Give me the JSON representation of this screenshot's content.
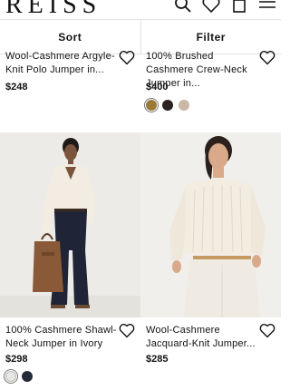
{
  "header": {
    "logo": "REISS"
  },
  "toolbar": {
    "sort_label": "Sort",
    "filter_label": "Filter"
  },
  "products_top": [
    {
      "title": "Wool-Cashmere Argyle-Knit Polo Jumper in...",
      "price": "$248"
    },
    {
      "title": "100% Brushed Cashmere Crew-Neck Jumper in...",
      "price": "$400",
      "swatches": [
        {
          "color": "#9a7a35",
          "name": "camel"
        },
        {
          "color": "#2a2121",
          "name": "black"
        },
        {
          "color": "#cbb8a6",
          "name": "oatmeal"
        }
      ]
    }
  ],
  "products_bottom": [
    {
      "title": "100% Cashmere Shawl-Neck Jumper in Ivory",
      "price": "$298",
      "swatches": [
        {
          "color": "#e8e6e0",
          "name": "ivory"
        },
        {
          "color": "#252a3a",
          "name": "navy"
        }
      ]
    },
    {
      "title": "Wool-Cashmere Jacquard-Knit Jumper...",
      "price": "$285"
    }
  ],
  "icons": [
    "search-icon",
    "heart-icon",
    "bag-icon",
    "menu-icon",
    "wishlist-heart-icon"
  ]
}
